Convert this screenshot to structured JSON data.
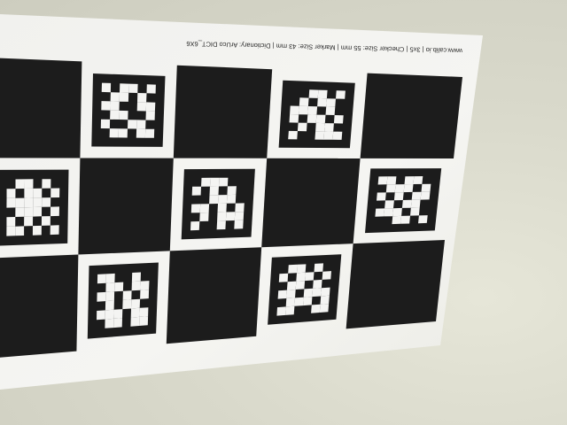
{
  "scene": {
    "wall_color": "#d9d9cb",
    "paper_color": "#f4f4f2",
    "ink_color": "#1c1c1c"
  },
  "board": {
    "caption": "www.calib.io | 3x5 | Checker Size: 55 mm | Marker Size: 43 mm | Dictionary: ArUco DICT_6X6",
    "rows": 3,
    "columns": 5,
    "cells": [
      [
        "black",
        "marker",
        "black",
        "marker",
        "black"
      ],
      [
        "marker",
        "black",
        "marker",
        "black",
        "marker"
      ],
      [
        "black",
        "marker",
        "black",
        "marker",
        "black"
      ]
    ]
  },
  "markers": [
    {
      "id": "r0c1",
      "bits": [
        [
          1,
          0,
          1,
          1,
          0,
          1
        ],
        [
          0,
          1,
          1,
          0,
          1,
          0
        ],
        [
          1,
          1,
          0,
          0,
          1,
          1
        ],
        [
          0,
          1,
          1,
          0,
          0,
          1
        ],
        [
          1,
          0,
          0,
          1,
          1,
          0
        ],
        [
          0,
          1,
          1,
          0,
          1,
          1
        ]
      ]
    },
    {
      "id": "r0c3",
      "bits": [
        [
          0,
          0,
          1,
          1,
          0,
          1
        ],
        [
          0,
          1,
          0,
          1,
          1,
          0
        ],
        [
          1,
          1,
          1,
          0,
          1,
          0
        ],
        [
          1,
          0,
          1,
          1,
          0,
          1
        ],
        [
          0,
          1,
          0,
          1,
          1,
          0
        ],
        [
          1,
          0,
          0,
          1,
          1,
          1
        ]
      ]
    },
    {
      "id": "r1c0",
      "bits": [
        [
          0,
          1,
          1,
          0,
          1,
          0
        ],
        [
          1,
          0,
          1,
          1,
          0,
          1
        ],
        [
          1,
          1,
          1,
          1,
          1,
          0
        ],
        [
          0,
          1,
          1,
          1,
          0,
          1
        ],
        [
          1,
          0,
          1,
          0,
          1,
          0
        ],
        [
          1,
          1,
          0,
          1,
          0,
          1
        ]
      ]
    },
    {
      "id": "r1c2",
      "bits": [
        [
          0,
          1,
          1,
          1,
          0,
          0
        ],
        [
          1,
          0,
          1,
          0,
          1,
          0
        ],
        [
          0,
          0,
          1,
          1,
          1,
          0
        ],
        [
          1,
          1,
          0,
          1,
          0,
          1
        ],
        [
          0,
          1,
          0,
          1,
          1,
          1
        ],
        [
          1,
          0,
          0,
          1,
          0,
          1
        ]
      ]
    },
    {
      "id": "r1c4",
      "bits": [
        [
          1,
          1,
          0,
          1,
          1,
          0
        ],
        [
          0,
          1,
          1,
          1,
          0,
          1
        ],
        [
          1,
          0,
          1,
          0,
          1,
          1
        ],
        [
          0,
          1,
          0,
          1,
          1,
          0
        ],
        [
          1,
          1,
          1,
          0,
          1,
          0
        ],
        [
          0,
          0,
          1,
          1,
          0,
          1
        ]
      ]
    },
    {
      "id": "r2c1",
      "bits": [
        [
          1,
          1,
          0,
          0,
          1,
          0
        ],
        [
          0,
          1,
          1,
          0,
          1,
          1
        ],
        [
          1,
          1,
          0,
          1,
          0,
          1
        ],
        [
          0,
          1,
          0,
          1,
          1,
          0
        ],
        [
          1,
          1,
          1,
          0,
          1,
          1
        ],
        [
          0,
          1,
          1,
          0,
          1,
          1
        ]
      ]
    },
    {
      "id": "r2c3",
      "bits": [
        [
          0,
          1,
          1,
          0,
          1,
          0
        ],
        [
          1,
          0,
          1,
          1,
          0,
          1
        ],
        [
          0,
          1,
          1,
          0,
          1,
          0
        ],
        [
          1,
          1,
          0,
          1,
          1,
          1
        ],
        [
          0,
          1,
          1,
          1,
          0,
          1
        ],
        [
          1,
          1,
          0,
          0,
          1,
          1
        ]
      ]
    }
  ]
}
